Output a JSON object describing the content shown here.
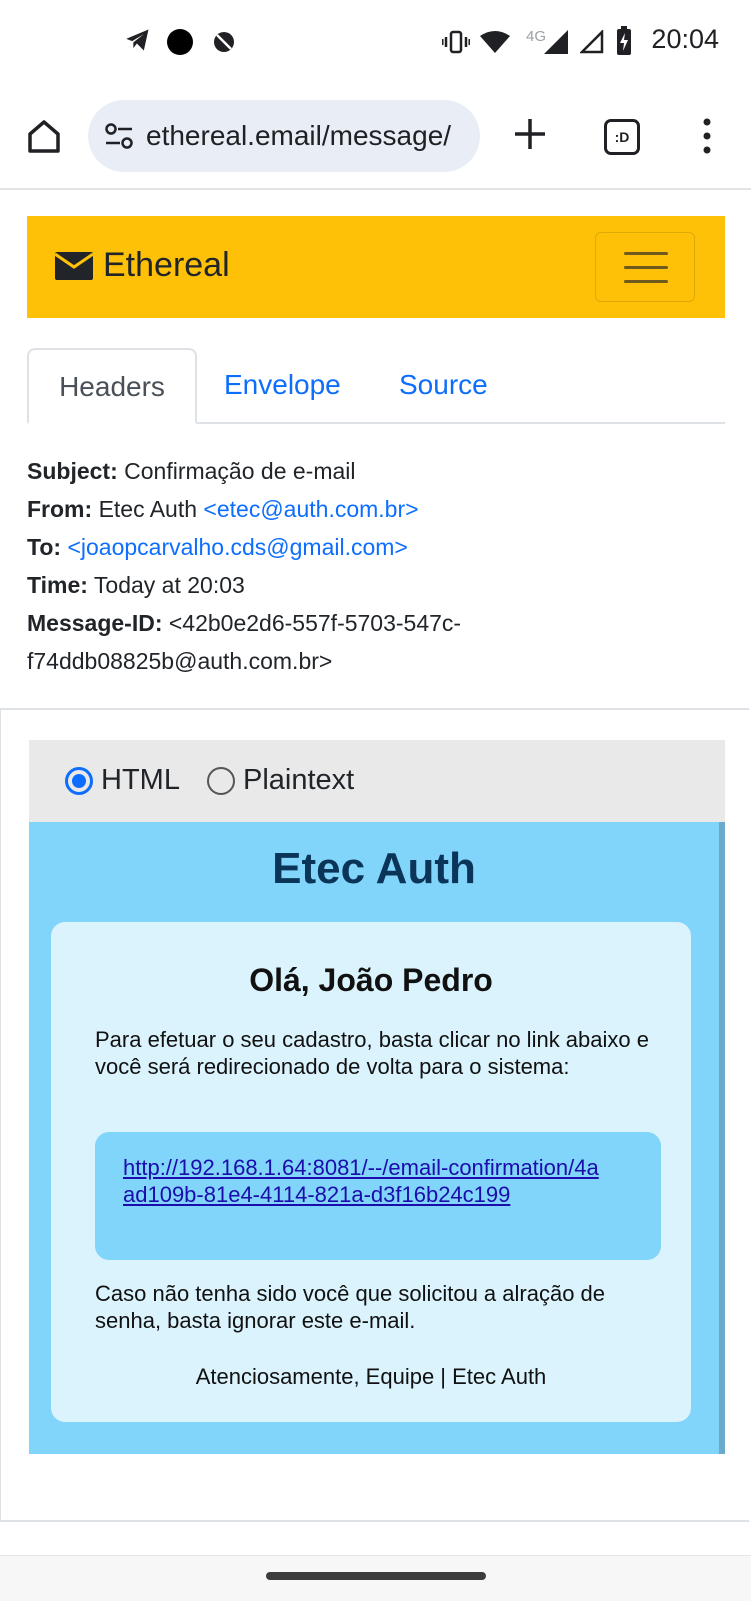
{
  "status_bar": {
    "time": "20:04",
    "network_label": "4G",
    "icons": [
      "telegram-icon",
      "dot-icon",
      "blocked-notification-icon",
      "vibrate-icon",
      "wifi-icon",
      "signal-icon",
      "signal-empty-icon",
      "battery-charging-icon"
    ]
  },
  "browser": {
    "url": "ethereal.email/message/",
    "tab_count_label": ":D"
  },
  "navbar": {
    "brand": "Ethereal",
    "brand_color": "#ffc107"
  },
  "tabs": [
    {
      "label": "Headers",
      "active": true
    },
    {
      "label": "Envelope",
      "active": false
    },
    {
      "label": "Source",
      "active": false
    }
  ],
  "headers": {
    "subject_label": "Subject:",
    "subject": "Confirmação de e-mail",
    "from_label": "From:",
    "from_name": "Etec Auth",
    "from_address": "<etec@auth.com.br>",
    "to_label": "To:",
    "to_address": "<joaopcarvalho.cds@gmail.com>",
    "time_label": "Time:",
    "time": "Today at 20:03",
    "message_id_label": "Message-ID:",
    "message_id_line1": "<42b0e2d6-557f-5703-547c-",
    "message_id_line2": "f74ddb08825b@auth.com.br>"
  },
  "format": {
    "options": [
      {
        "label": "HTML",
        "selected": true
      },
      {
        "label": "Plaintext",
        "selected": false
      }
    ]
  },
  "email": {
    "brand": "Etec Auth",
    "greeting": "Olá, João Pedro",
    "intro": "Para efetuar o seu cadastro, basta clicar no link abaixo e você será redirecionado de volta para o sistema:",
    "link": "http://192.168.1.64:8081/--/email-confirmation/4aad109b-81e4-4114-821a-d3f16b24c199",
    "ignore_note": "Caso não tenha sido você que solicitou a alração de senha, basta ignorar este e-mail.",
    "signoff": "Atenciosamente, Equipe | Etec Auth",
    "frame_color": "#81d4fa",
    "box_color": "#dbf3fd"
  }
}
